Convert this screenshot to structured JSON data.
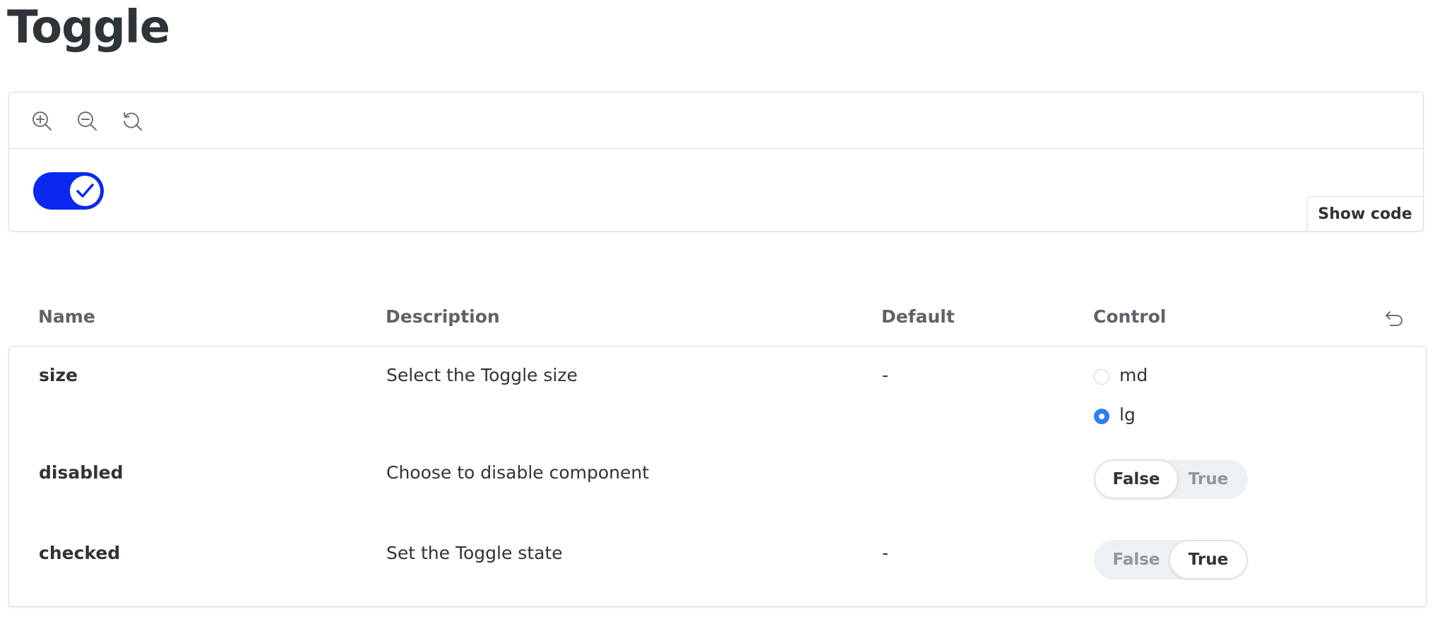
{
  "page": {
    "title": "Toggle"
  },
  "preview": {
    "toolbar": [
      {
        "icon": "zoom-in-icon"
      },
      {
        "icon": "zoom-out-icon"
      },
      {
        "icon": "reset-zoom-icon"
      }
    ],
    "toggle": {
      "checked": true,
      "color": "#0a28f0"
    },
    "show_code_label": "Show code"
  },
  "args_table": {
    "headers": {
      "name": "Name",
      "description": "Description",
      "default": "Default",
      "control": "Control"
    },
    "reset_icon": "undo-icon",
    "rows": [
      {
        "name": "size",
        "description": "Select the Toggle size",
        "default": "-",
        "control": {
          "type": "radio",
          "options": [
            "md",
            "lg"
          ],
          "selected": "lg"
        }
      },
      {
        "name": "disabled",
        "description": "Choose to disable component",
        "default": "",
        "control": {
          "type": "boolean",
          "false_label": "False",
          "true_label": "True",
          "value": false
        }
      },
      {
        "name": "checked",
        "description": "Set the Toggle state",
        "default": "-",
        "control": {
          "type": "boolean",
          "false_label": "False",
          "true_label": "True",
          "value": true
        }
      }
    ]
  },
  "colors": {
    "accent": "#0a28f0",
    "radio_selected": "#2f7ef0",
    "border": "#d9dde1"
  }
}
